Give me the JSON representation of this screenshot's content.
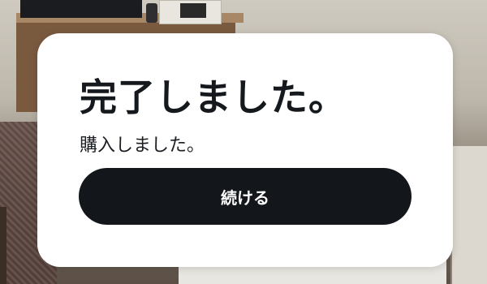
{
  "dialog": {
    "title": "完了しました。",
    "message": "購入しました。",
    "continue_label": "続ける"
  }
}
